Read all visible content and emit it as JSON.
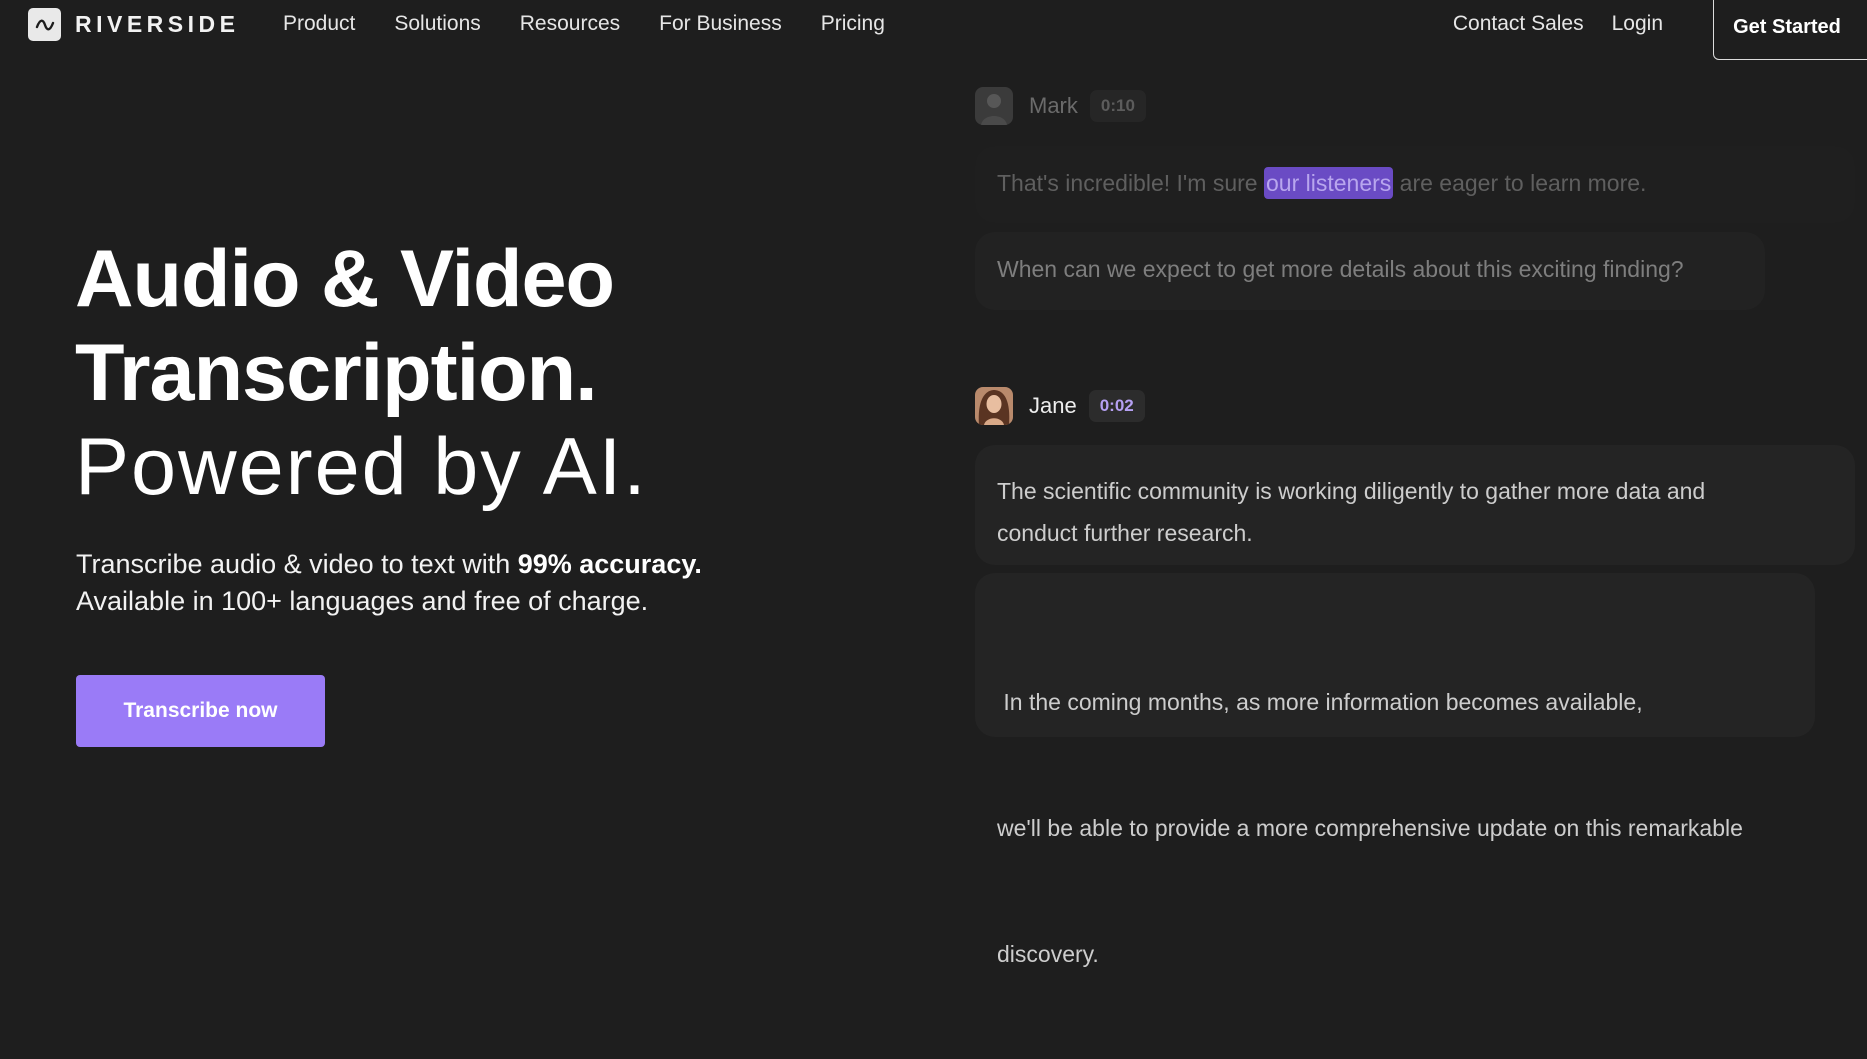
{
  "nav": {
    "brand": "RIVERSIDE",
    "links": [
      "Product",
      "Solutions",
      "Resources",
      "For Business",
      "Pricing"
    ],
    "contact_sales": "Contact Sales",
    "login": "Login",
    "get_started": "Get Started"
  },
  "hero": {
    "title_line1": "Audio & Video",
    "title_line2": "Transcription.",
    "title_line3": "Powered by AI.",
    "subtitle_prefix": "Transcribe audio & video to text with ",
    "subtitle_bold": "99% accuracy.",
    "subtitle_line2": "Available in 100+ languages and free of charge.",
    "cta": "Transcribe now"
  },
  "transcript": {
    "mark": {
      "name": "Mark",
      "time": "0:10",
      "line1_before": "That's incredible! I'm sure ",
      "line1_highlight": "our listeners",
      "line1_after": " are eager to learn more.",
      "line2": "When can we expect to get more details about this exciting finding?"
    },
    "jane": {
      "name": "Jane",
      "time": "0:02",
      "block1_line1": "The scientific community is working diligently to gather more data and",
      "block1_line2": "conduct further research.",
      "block2_line1": " In the coming months, as more information becomes available,",
      "block2_line2": "we'll be able to provide a more comprehensive update on this remarkable",
      "block2_line3": "discovery."
    }
  },
  "colors": {
    "background": "#1e1e1e",
    "accent": "#9a7bf7",
    "highlight": "#6a4bc4",
    "bubble": "#242424"
  }
}
